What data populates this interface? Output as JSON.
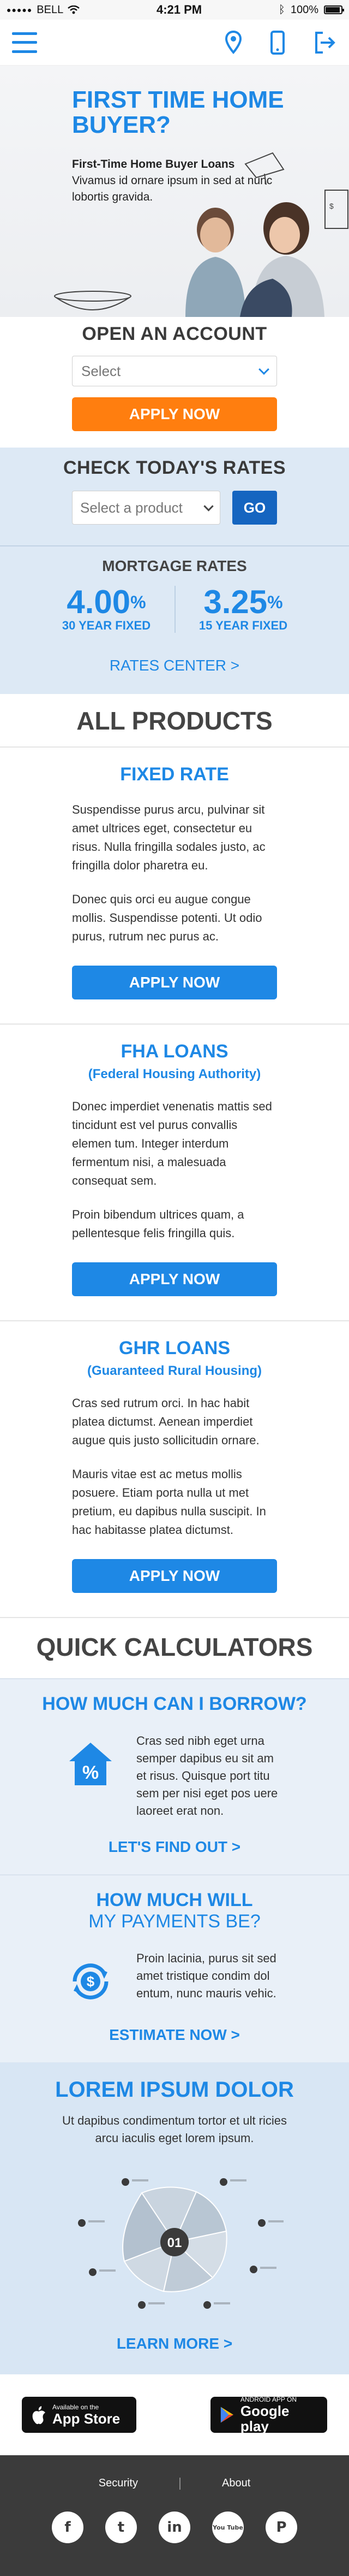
{
  "status_bar": {
    "carrier": "BELL",
    "time": "4:21 PM",
    "battery": "100%"
  },
  "header": {
    "icons": [
      "menu-icon",
      "location-pin-icon",
      "phone-icon",
      "login-icon"
    ]
  },
  "hero": {
    "title": "FIRST TIME HOME BUYER?",
    "subtitle_bold": "First-Time Home Buyer Loans",
    "subtitle_text": "Vivamus id ornare ipsum in sed at nunc lobortis gravida."
  },
  "open_account": {
    "heading": "OPEN AN ACCOUNT",
    "select_value": "Select",
    "button": "APPLY NOW"
  },
  "rates": {
    "heading": "CHECK TODAY'S RATES",
    "select_value": "Select a product",
    "go": "GO",
    "mortgage_label": "MORTGAGE RATES",
    "items": [
      {
        "value": "4.00",
        "unit": "%",
        "term": "30 YEAR FIXED"
      },
      {
        "value": "3.25",
        "unit": "%",
        "term": "15 YEAR FIXED"
      }
    ],
    "center_link": "RATES CENTER >"
  },
  "products": {
    "heading": "ALL PRODUCTS",
    "items": [
      {
        "title": "FIXED RATE",
        "subtitle": "",
        "para1": "Suspendisse purus arcu, pulvinar sit amet ultrices eget, consectetur eu risus. Nulla fringilla sodales justo, ac fringilla dolor pharetra eu.",
        "para2": "Donec quis orci eu augue congue mollis. Suspendisse potenti. Ut odio purus, rutrum nec purus ac.",
        "button": "APPLY NOW"
      },
      {
        "title": "FHA LOANS",
        "subtitle": "(Federal Housing Authority)",
        "para1": "Donec imperdiet venenatis mattis sed tincidunt est vel purus convallis elemen tum. Integer interdum fermentum nisi, a malesuada consequat sem.",
        "para2": "Proin bibendum ultrices quam, a pellentesque felis fringilla quis.",
        "button": "APPLY NOW"
      },
      {
        "title": "GHR LOANS",
        "subtitle": "(Guaranteed Rural Housing)",
        "para1": "Cras sed rutrum orci. In hac habit platea dictumst. Aenean imperdiet augue quis justo sollicitudin ornare.",
        "para2": "Mauris vitae est ac metus mollis posuere. Etiam porta nulla ut met pretium, eu dapibus nulla suscipit. In hac habitasse platea dictumst.",
        "button": "APPLY NOW"
      }
    ]
  },
  "calculators": {
    "heading": "QUICK CALCULATORS",
    "items": [
      {
        "title_line1": "HOW MUCH CAN I BORROW?",
        "title_line2": "",
        "text": "Cras sed nibh eget urna semper dapibus eu sit am et risus. Quisque port titu sem per nisi eget pos uere laoreet erat non.",
        "link": "LET'S FIND OUT >",
        "icon": "house-percent-icon"
      },
      {
        "title_line1": "HOW MUCH WILL",
        "title_line2": "MY PAYMENTS BE?",
        "text": "Proin lacinia, purus sit sed amet tristique condim dol entum, nunc mauris vehic.",
        "link": "ESTIMATE NOW >",
        "icon": "dollar-cycle-icon"
      }
    ]
  },
  "lorem": {
    "title": "LOREM IPSUM DOLOR",
    "subtitle": "Ut dapibus condimentum tortor et ult ricies arcu iaculis eget lorem ipsum.",
    "fan_label": "01",
    "link": "LEARN MORE >"
  },
  "badges": {
    "app_store_small": "Available on the",
    "app_store_big": "App Store",
    "google_small": "ANDROID APP ON",
    "google_big": "Google play"
  },
  "footer": {
    "security": "Security",
    "about": "About",
    "social": [
      {
        "name": "facebook-icon",
        "glyph": "f"
      },
      {
        "name": "twitter-icon",
        "glyph": "t"
      },
      {
        "name": "linkedin-icon",
        "glyph": "in"
      },
      {
        "name": "youtube-icon",
        "glyph": "You Tube"
      },
      {
        "name": "pinterest-icon",
        "glyph": "P"
      }
    ]
  },
  "colors": {
    "brand_blue": "#1e88e5",
    "orange": "#ff7e0f",
    "dark_blue": "#1565c0",
    "rates_bg": "#dde9f5",
    "footer_bg": "#3b3b3b"
  }
}
